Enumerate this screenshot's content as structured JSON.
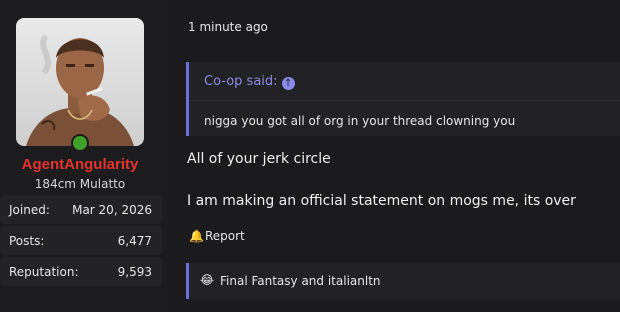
{
  "user": {
    "name": "AgentAngularity",
    "title": "184cm Mulatto",
    "stats": [
      {
        "label": "Joined:",
        "value": "Mar 20, 2026"
      },
      {
        "label": "Posts:",
        "value": "6,477"
      },
      {
        "label": "Reputation:",
        "value": "9,593"
      }
    ]
  },
  "post": {
    "time": "1 minute ago",
    "quote": {
      "author": "Co-op said:",
      "text": "nigga you got all of org in your thread clowning you"
    },
    "lines": [
      "All of your jerk circle",
      "I am making an official statement on mogs me, its over"
    ],
    "report_label": "Report",
    "reactions": {
      "emoji": "😂",
      "text": "Final Fantasy and italianltn"
    }
  },
  "colors": {
    "username": "#e5342f",
    "quote_accent": "#6f6fd8",
    "online": "#3fa12a"
  }
}
